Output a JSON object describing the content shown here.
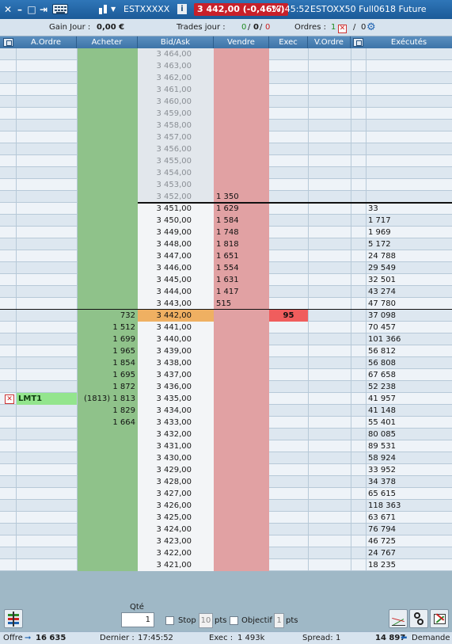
{
  "titlebar": {
    "instrument": "ESTXXXXX",
    "info": "i",
    "price_badge": "3 442,00 (-0,46%)",
    "time": "17:45:52",
    "contract": "ESTOXX50 Full0618 Future"
  },
  "summary": {
    "gain_label": "Gain Jour :",
    "gain_value": "0,00 €",
    "trades_label": "Trades jour :",
    "trades_a": "0",
    "trades_b": "0",
    "trades_c": "0",
    "sep": "/",
    "orders_label": "Ordres :",
    "orders_count": "1",
    "orders_slash": "/",
    "orders_zero": "0"
  },
  "headers": {
    "a_ordre": "A.Ordre",
    "acheter": "Acheter",
    "bid_ask": "Bid/Ask",
    "vendre": "Vendre",
    "exec": "Exec",
    "v_ordre": "V.Ordre",
    "executes": "Exécutés"
  },
  "ladder": {
    "prices": [
      "3 464,00",
      "3 463,00",
      "3 462,00",
      "3 461,00",
      "3 460,00",
      "3 459,00",
      "3 458,00",
      "3 457,00",
      "3 456,00",
      "3 455,00",
      "3 454,00",
      "3 453,00",
      "3 452,00",
      "3 451,00",
      "3 450,00",
      "3 449,00",
      "3 448,00",
      "3 447,00",
      "3 446,00",
      "3 445,00",
      "3 444,00",
      "3 443,00",
      "3 442,00",
      "3 441,00",
      "3 440,00",
      "3 439,00",
      "3 438,00",
      "3 437,00",
      "3 436,00",
      "3 435,00",
      "3 434,00",
      "3 433,00",
      "3 432,00",
      "3 431,00",
      "3 430,00",
      "3 429,00",
      "3 428,00",
      "3 427,00",
      "3 426,00",
      "3 425,00",
      "3 424,00",
      "3 423,00",
      "3 422,00",
      "3 421,00"
    ],
    "buy": [
      "",
      "",
      "",
      "",
      "",
      "",
      "",
      "",
      "",
      "",
      "",
      "",
      "",
      "",
      "",
      "",
      "",
      "",
      "",
      "",
      "",
      "",
      "732",
      "1 512",
      "1 699",
      "1 965",
      "1 854",
      "1 695",
      "1 872",
      "(1813) 1 813",
      "1 829",
      "1 664",
      "",
      "",
      "",
      "",
      "",
      "",
      "",
      "",
      "",
      "",
      "",
      ""
    ],
    "sell": [
      "",
      "",
      "",
      "",
      "",
      "",
      "",
      "",
      "",
      "",
      "",
      "",
      "1 350",
      "1 629",
      "1 584",
      "1 748",
      "1 818",
      "1 651",
      "1 554",
      "1 631",
      "1 417",
      "515",
      "",
      "",
      "",
      "",
      "",
      "",
      "",
      "",
      "",
      "",
      "",
      "",
      "",
      "",
      "",
      "",
      "",
      "",
      "",
      "",
      "",
      ""
    ],
    "exec": [
      "",
      "",
      "",
      "",
      "",
      "",
      "",
      "",
      "",
      "",
      "",
      "",
      "",
      "",
      "",
      "",
      "",
      "",
      "",
      "",
      "",
      "",
      "95",
      "",
      "",
      "",
      "",
      "",
      "",
      "",
      "",
      "",
      "",
      "",
      "",
      "",
      "",
      "",
      "",
      "",
      "",
      "",
      "",
      ""
    ],
    "executed": [
      "",
      "",
      "",
      "",
      "",
      "",
      "",
      "",
      "",
      "",
      "",
      "",
      "",
      "33",
      "1 717",
      "1 969",
      "5 172",
      "24 788",
      "29 549",
      "32 501",
      "43 274",
      "47 780",
      "37 098",
      "70 457",
      "101 366",
      "56 812",
      "56 808",
      "67 658",
      "52 238",
      "41 957",
      "41 148",
      "55 401",
      "80 085",
      "89 531",
      "58 924",
      "33 952",
      "34 378",
      "65 615",
      "118 363",
      "63 671",
      "76 794",
      "46 725",
      "24 767",
      "18 235"
    ],
    "order_label": "LMT1"
  },
  "bottom": {
    "qty_label": "Qté",
    "qty_value": "1",
    "stop_label": "Stop",
    "stop_value": "10",
    "pts_label": "pts",
    "objectif_label": "Objectif",
    "objectif_value": "1",
    "pts_label_2": "pts"
  },
  "status": {
    "offre_label": "Offre",
    "offre_value": "16 635",
    "dernier_label": "Dernier :",
    "dernier_value": "17:45:52",
    "exec_label": "Exec :",
    "exec_value": "1 493k",
    "spread_label": "Spread:",
    "spread_value": "1",
    "demande_value": "14 897",
    "demande_label": "Demande"
  },
  "colors": {
    "buy_column": "#8fc28a",
    "sell_column": "#e1a1a3",
    "last_price": "#efb062",
    "exec_highlight": "#f05d5d",
    "price_badge": "#c8202a",
    "order_badge": "#93e58d"
  },
  "icons": [
    "close-icon",
    "pin-icon",
    "restore-icon",
    "maximize-icon",
    "keyboard-icon",
    "instrument-icon",
    "info-icon",
    "cancel-orders-icon",
    "settings-gear-icon",
    "cancel-buy-orders-icon",
    "cancel-sell-orders-icon",
    "order-ladder-icon",
    "chart-icon",
    "link-icon",
    "export-icon",
    "offer-arrow-icon",
    "demand-arrow-icon"
  ]
}
